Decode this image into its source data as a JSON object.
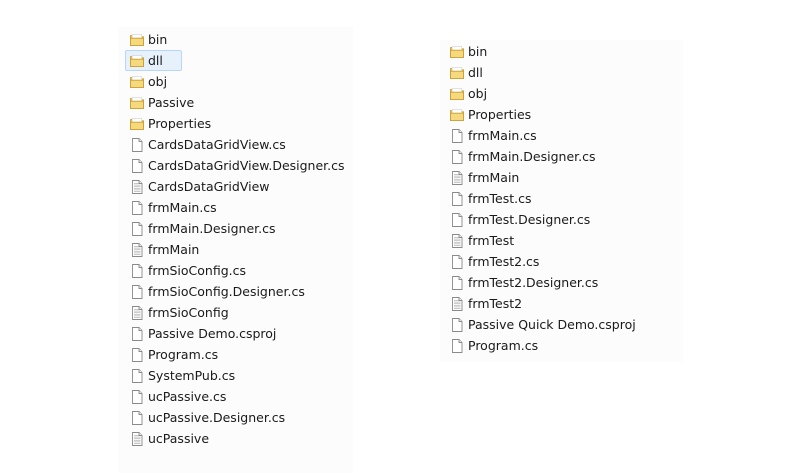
{
  "left_pane": {
    "items": [
      {
        "label": "bin",
        "icon": "folder-icon",
        "name": "folder-bin"
      },
      {
        "label": "dll",
        "icon": "folder-icon",
        "name": "folder-dll",
        "selected": true
      },
      {
        "label": "obj",
        "icon": "folder-icon",
        "name": "folder-obj"
      },
      {
        "label": "Passive",
        "icon": "folder-icon",
        "name": "folder-passive"
      },
      {
        "label": "Properties",
        "icon": "folder-icon",
        "name": "folder-properties"
      },
      {
        "label": "CardsDataGridView.cs",
        "icon": "file-icon",
        "name": "file-cardsdatagridview-cs"
      },
      {
        "label": "CardsDataGridView.Designer.cs",
        "icon": "file-icon",
        "name": "file-cardsdatagridview-designer-cs"
      },
      {
        "label": "CardsDataGridView",
        "icon": "text-file-icon",
        "name": "file-cardsdatagridview-resx"
      },
      {
        "label": "frmMain.cs",
        "icon": "file-icon",
        "name": "file-frmmain-cs"
      },
      {
        "label": "frmMain.Designer.cs",
        "icon": "file-icon",
        "name": "file-frmmain-designer-cs"
      },
      {
        "label": "frmMain",
        "icon": "text-file-icon",
        "name": "file-frmmain-resx"
      },
      {
        "label": "frmSioConfig.cs",
        "icon": "file-icon",
        "name": "file-frmsioconfig-cs"
      },
      {
        "label": "frmSioConfig.Designer.cs",
        "icon": "file-icon",
        "name": "file-frmsioconfig-designer-cs"
      },
      {
        "label": "frmSioConfig",
        "icon": "text-file-icon",
        "name": "file-frmsioconfig-resx"
      },
      {
        "label": "Passive Demo.csproj",
        "icon": "file-icon",
        "name": "file-passive-demo-csproj"
      },
      {
        "label": "Program.cs",
        "icon": "file-icon",
        "name": "file-program-cs"
      },
      {
        "label": "SystemPub.cs",
        "icon": "file-icon",
        "name": "file-systempub-cs"
      },
      {
        "label": "ucPassive.cs",
        "icon": "file-icon",
        "name": "file-ucpassive-cs"
      },
      {
        "label": "ucPassive.Designer.cs",
        "icon": "file-icon",
        "name": "file-ucpassive-designer-cs"
      },
      {
        "label": "ucPassive",
        "icon": "text-file-icon",
        "name": "file-ucpassive-resx"
      }
    ]
  },
  "right_pane": {
    "items": [
      {
        "label": "bin",
        "icon": "folder-icon",
        "name": "folder-bin"
      },
      {
        "label": "dll",
        "icon": "folder-icon",
        "name": "folder-dll"
      },
      {
        "label": "obj",
        "icon": "folder-icon",
        "name": "folder-obj"
      },
      {
        "label": "Properties",
        "icon": "folder-icon",
        "name": "folder-properties"
      },
      {
        "label": "frmMain.cs",
        "icon": "file-icon",
        "name": "file-frmmain-cs"
      },
      {
        "label": "frmMain.Designer.cs",
        "icon": "file-icon",
        "name": "file-frmmain-designer-cs"
      },
      {
        "label": "frmMain",
        "icon": "text-file-icon",
        "name": "file-frmmain-resx"
      },
      {
        "label": "frmTest.cs",
        "icon": "file-icon",
        "name": "file-frmtest-cs"
      },
      {
        "label": "frmTest.Designer.cs",
        "icon": "file-icon",
        "name": "file-frmtest-designer-cs"
      },
      {
        "label": "frmTest",
        "icon": "text-file-icon",
        "name": "file-frmtest-resx"
      },
      {
        "label": "frmTest2.cs",
        "icon": "file-icon",
        "name": "file-frmtest2-cs"
      },
      {
        "label": "frmTest2.Designer.cs",
        "icon": "file-icon",
        "name": "file-frmtest2-designer-cs"
      },
      {
        "label": "frmTest2",
        "icon": "text-file-icon",
        "name": "file-frmtest2-resx"
      },
      {
        "label": "Passive Quick Demo.csproj",
        "icon": "file-icon",
        "name": "file-passive-quick-demo-csproj"
      },
      {
        "label": "Program.cs",
        "icon": "file-icon",
        "name": "file-program-cs"
      }
    ]
  },
  "colors": {
    "folder_body": "#e8c25a",
    "folder_front": "#f6d97c",
    "file_border": "#8a8a8a",
    "selection_bg": "#e7f1fc",
    "selection_border": "#b8d6fb"
  }
}
